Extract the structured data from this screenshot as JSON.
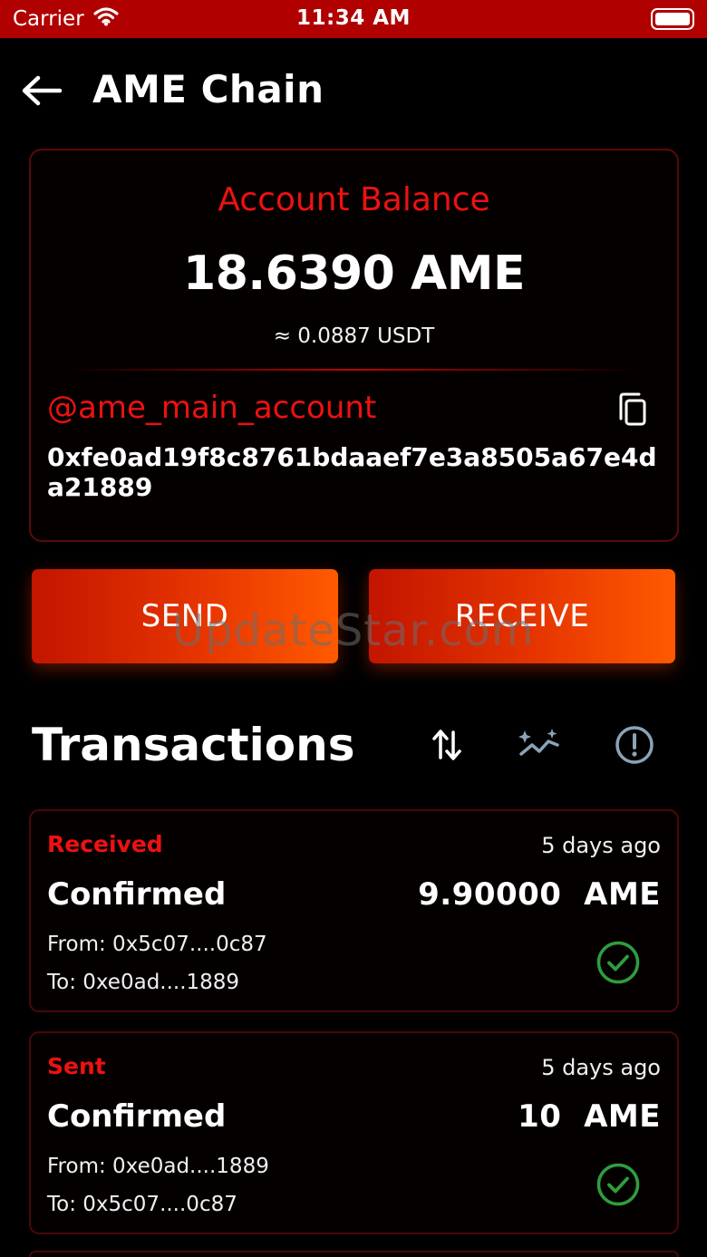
{
  "status_bar": {
    "carrier": "Carrier",
    "time": "11:34 AM"
  },
  "header": {
    "title": "AME Chain"
  },
  "balance": {
    "label": "Account Balance",
    "amount": "18.6390 AME",
    "fiat": "≈ 0.0887 USDT",
    "account_name": "@ame_main_account",
    "address": "0xfe0ad19f8c8761bdaaef7e3a8505a67e4da21889"
  },
  "actions": {
    "send_label": "SEND",
    "receive_label": "RECEIVE"
  },
  "watermark": "UpdateStar.com",
  "transactions": {
    "title": "Transactions",
    "items": [
      {
        "type": "Received",
        "time": "5 days ago",
        "status": "Confirmed",
        "amount": "9.90000  AME",
        "from": "From: 0x5c07....0c87",
        "to": "To: 0xe0ad....1889"
      },
      {
        "type": "Sent",
        "time": "5 days ago",
        "status": "Confirmed",
        "amount": "10  AME",
        "from": "From: 0xe0ad....1889",
        "to": "To: 0x5c07....0c87"
      }
    ]
  },
  "colors": {
    "accent_red": "#ee1111",
    "status_bar": "#b00000",
    "button_gradient_start": "#c31500",
    "button_gradient_end": "#ff5a00",
    "success_green": "#2e9e3e",
    "icon_slate": "#8ba3b8"
  },
  "icons": {
    "back": "arrow-left-icon",
    "copy": "copy-icon",
    "sort": "sort-arrows-icon",
    "chart": "chart-sparkle-icon",
    "info": "info-circle-icon",
    "check": "check-circle-icon",
    "wifi": "wifi-icon",
    "battery": "battery-icon"
  }
}
